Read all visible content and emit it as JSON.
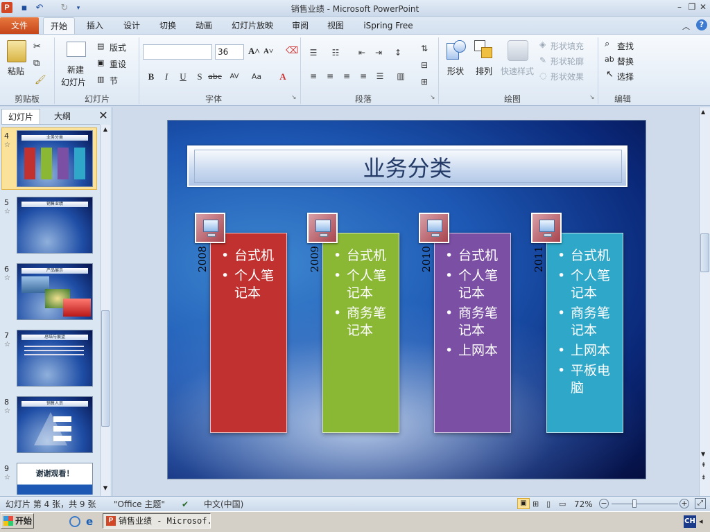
{
  "window": {
    "title": "销售业绩 - Microsoft PowerPoint",
    "app_icon": "P"
  },
  "ribbon_tabs": {
    "file": "文件",
    "tabs": [
      "开始",
      "插入",
      "设计",
      "切换",
      "动画",
      "幻灯片放映",
      "审阅",
      "视图",
      "iSpring Free"
    ]
  },
  "ribbon": {
    "clipboard": {
      "paste": "粘贴",
      "label": "剪贴板"
    },
    "slides": {
      "new_slide_1": "新建",
      "new_slide_2": "幻灯片",
      "layout": "版式",
      "reset": "重设",
      "section": "节",
      "label": "幻灯片"
    },
    "font": {
      "size": "36",
      "label": "字体",
      "font_name": ""
    },
    "paragraph": {
      "label": "段落"
    },
    "drawing": {
      "shape": "形状",
      "arrange": "排列",
      "quick_styles": "快速样式",
      "fill": "形状填充",
      "outline": "形状轮廓",
      "effects": "形状效果",
      "label": "绘图"
    },
    "editing": {
      "find": "查找",
      "replace": "替换",
      "select": "选择",
      "label": "编辑"
    }
  },
  "panel": {
    "tab_slides": "幻灯片",
    "tab_outline": "大纲",
    "close": "✕",
    "thumbnails": [
      {
        "num": "4",
        "title": "业务分类",
        "selected": true
      },
      {
        "num": "5",
        "title": "销售业绩",
        "selected": false
      },
      {
        "num": "6",
        "title": "产品展示",
        "selected": false
      },
      {
        "num": "7",
        "title": "总结与展望",
        "selected": false
      },
      {
        "num": "8",
        "title": "销售人员",
        "selected": false
      },
      {
        "num": "9",
        "title": "谢谢观看！",
        "selected": false
      }
    ]
  },
  "slide": {
    "title": "业务分类",
    "cards": [
      {
        "year": "2008",
        "color": "#c0312f",
        "items": [
          "台式机",
          "个人笔记本"
        ]
      },
      {
        "year": "2009",
        "color": "#8ab834",
        "items": [
          "台式机",
          "个人笔记本",
          "商务笔记本"
        ]
      },
      {
        "year": "2010",
        "color": "#7b4fa4",
        "items": [
          "台式机",
          "个人笔记本",
          "商务笔记本",
          "上网本"
        ]
      },
      {
        "year": "2011",
        "color": "#2ea7c9",
        "items": [
          "台式机",
          "个人笔记本",
          "商务笔记本",
          "上网本",
          "平板电脑"
        ]
      }
    ]
  },
  "status": {
    "slide_info": "幻灯片 第 4 张，共 9 张",
    "theme": "\"Office 主题\"",
    "language": "中文(中国)",
    "zoom": "72%"
  },
  "taskbar": {
    "start": "开始",
    "ppt_task": "销售业绩 - Microsof...",
    "ime": "CH"
  }
}
